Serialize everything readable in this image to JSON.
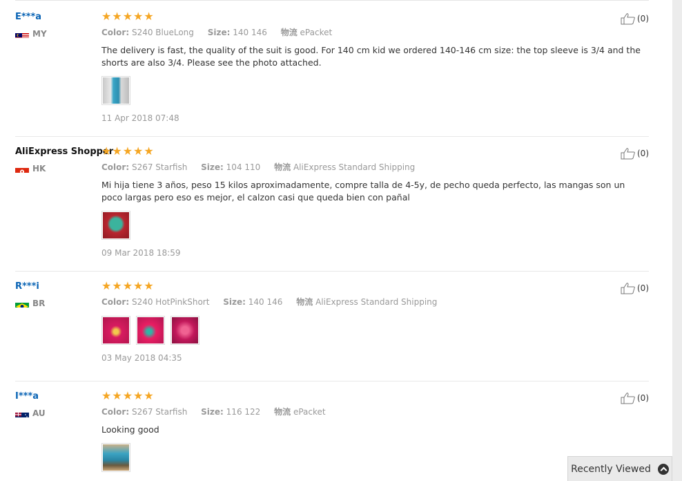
{
  "reviews": [
    {
      "user": "E***a",
      "country": "MY",
      "color_label": "Color:",
      "color_value": "S240 BlueLong",
      "size_label": "Size:",
      "size_value": "140 146",
      "ship_label": "物流",
      "ship_value": "ePacket",
      "text": "The delivery is fast, the quality of the suit is good. For 140 cm kid we ordered 140-146 cm size: the top sleeve is 3/4 and the shorts are also 3/4. Please see the photo attached.",
      "date": "11 Apr 2018 07:48",
      "helpful": "(0)"
    },
    {
      "user": "AliExpress Shopper",
      "country": "HK",
      "color_label": "Color:",
      "color_value": "S267 Starfish",
      "size_label": "Size:",
      "size_value": "104 110",
      "ship_label": "物流",
      "ship_value": "AliExpress Standard Shipping",
      "text": "Mi hija tiene 3 años, peso 15 kilos aproximadamente, compre talla de 4-5y, de pecho queda perfecto, las mangas son un poco largas pero eso es mejor, el calzon casi que queda bien con pañal",
      "date": "09 Mar 2018 18:59",
      "helpful": "(0)"
    },
    {
      "user": "R***i",
      "country": "BR",
      "color_label": "Color:",
      "color_value": "S240 HotPinkShort",
      "size_label": "Size:",
      "size_value": "140 146",
      "ship_label": "物流",
      "ship_value": "AliExpress Standard Shipping",
      "date": "03 May 2018 04:35",
      "helpful": "(0)"
    },
    {
      "user": "I***a",
      "country": "AU",
      "color_label": "Color:",
      "color_value": "S267 Starfish",
      "size_label": "Size:",
      "size_value": "116 122",
      "ship_label": "物流",
      "ship_value": "ePacket",
      "text": "Looking good",
      "helpful": "(0)"
    }
  ],
  "recently_viewed": "Recently Viewed",
  "colors": {
    "star": "#f5a623",
    "user_link": "#0a64b5"
  }
}
